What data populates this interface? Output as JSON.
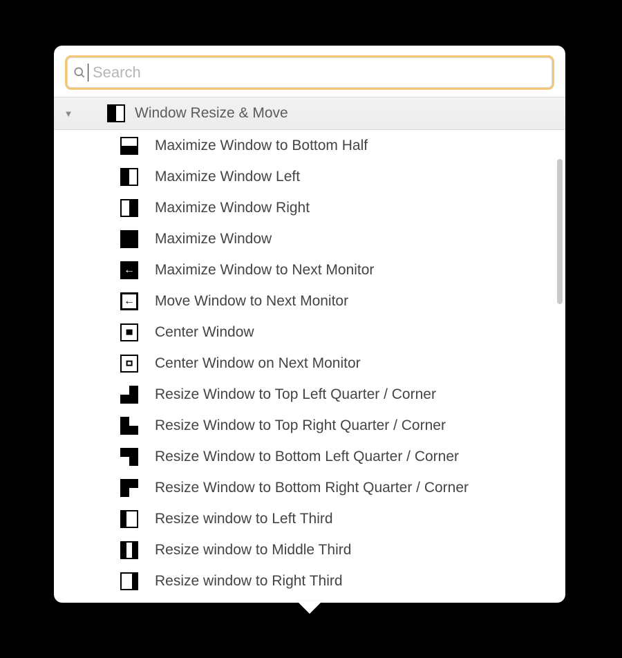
{
  "search": {
    "placeholder": "Search",
    "value": ""
  },
  "group": {
    "title": "Window Resize & Move",
    "expanded": true,
    "icon": "window-left-half-icon"
  },
  "items": [
    {
      "label": "Maximize Window to Bottom Half",
      "icon": "bottom-half-icon"
    },
    {
      "label": "Maximize Window Left",
      "icon": "left-half-icon"
    },
    {
      "label": "Maximize Window Right",
      "icon": "right-half-icon"
    },
    {
      "label": "Maximize Window",
      "icon": "full-icon"
    },
    {
      "label": "Maximize Window to Next Monitor",
      "icon": "arrow-left-solid-icon"
    },
    {
      "label": "Move Window to Next Monitor",
      "icon": "arrow-left-outline-icon"
    },
    {
      "label": "Center Window",
      "icon": "center-solid-icon"
    },
    {
      "label": "Center Window on Next Monitor",
      "icon": "center-outline-icon"
    },
    {
      "label": "Resize Window to Top Left Quarter / Corner",
      "icon": "quarter-top-left-inv-icon"
    },
    {
      "label": "Resize Window to Top Right Quarter / Corner",
      "icon": "quarter-top-right-inv-icon"
    },
    {
      "label": "Resize Window to Bottom Left Quarter / Corner",
      "icon": "quarter-bottom-left-inv-icon"
    },
    {
      "label": "Resize Window to Bottom Right Quarter / Corner",
      "icon": "quarter-bottom-right-inv-icon"
    },
    {
      "label": "Resize window to Left Third",
      "icon": "third-left-icon"
    },
    {
      "label": "Resize window to Middle Third",
      "icon": "third-middle-icon"
    },
    {
      "label": "Resize window to Right Third",
      "icon": "third-right-icon"
    }
  ]
}
